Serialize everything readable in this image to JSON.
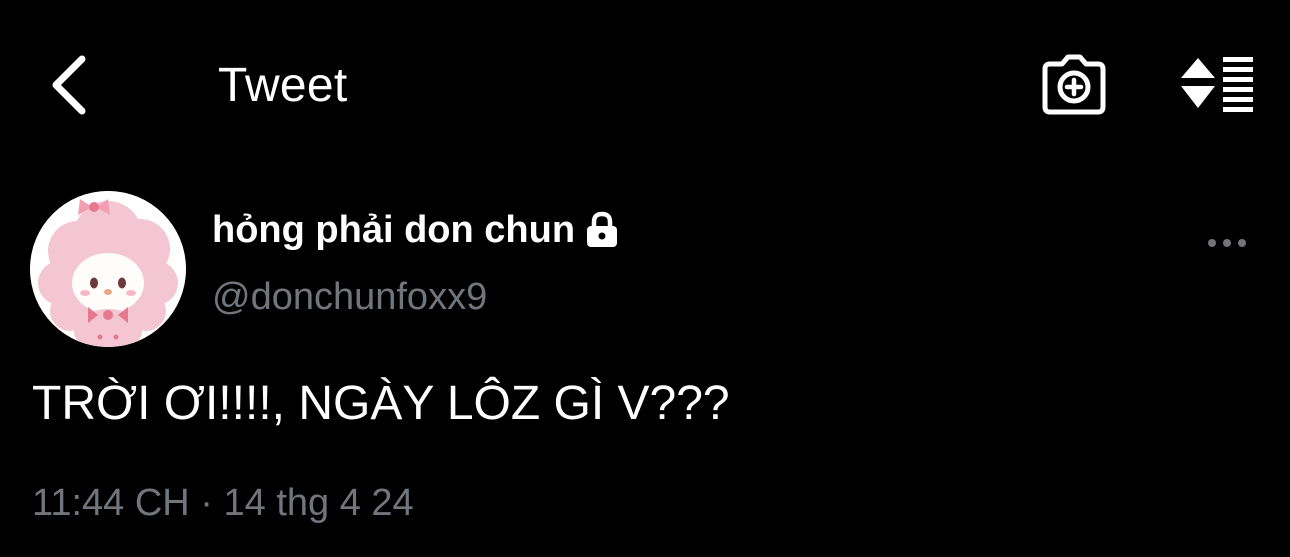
{
  "header": {
    "title": "Tweet",
    "back_icon": "chevron-left-icon",
    "camera_icon": "camera-add-icon",
    "sort_icon": "sort-list-icon"
  },
  "tweet": {
    "display_name": "hỏng phải don chun",
    "handle": "@donchunfoxx9",
    "protected": true,
    "text": "TRỜI ƠI!!!!, NGÀY LÔZ GÌ V???",
    "time": "11:44 CH",
    "separator": "·",
    "date": "14 thg 4 24"
  },
  "colors": {
    "background": "#000000",
    "primary_text": "#ffffff",
    "secondary_text": "#71767b",
    "avatar_bg": "#f4c6d4"
  }
}
